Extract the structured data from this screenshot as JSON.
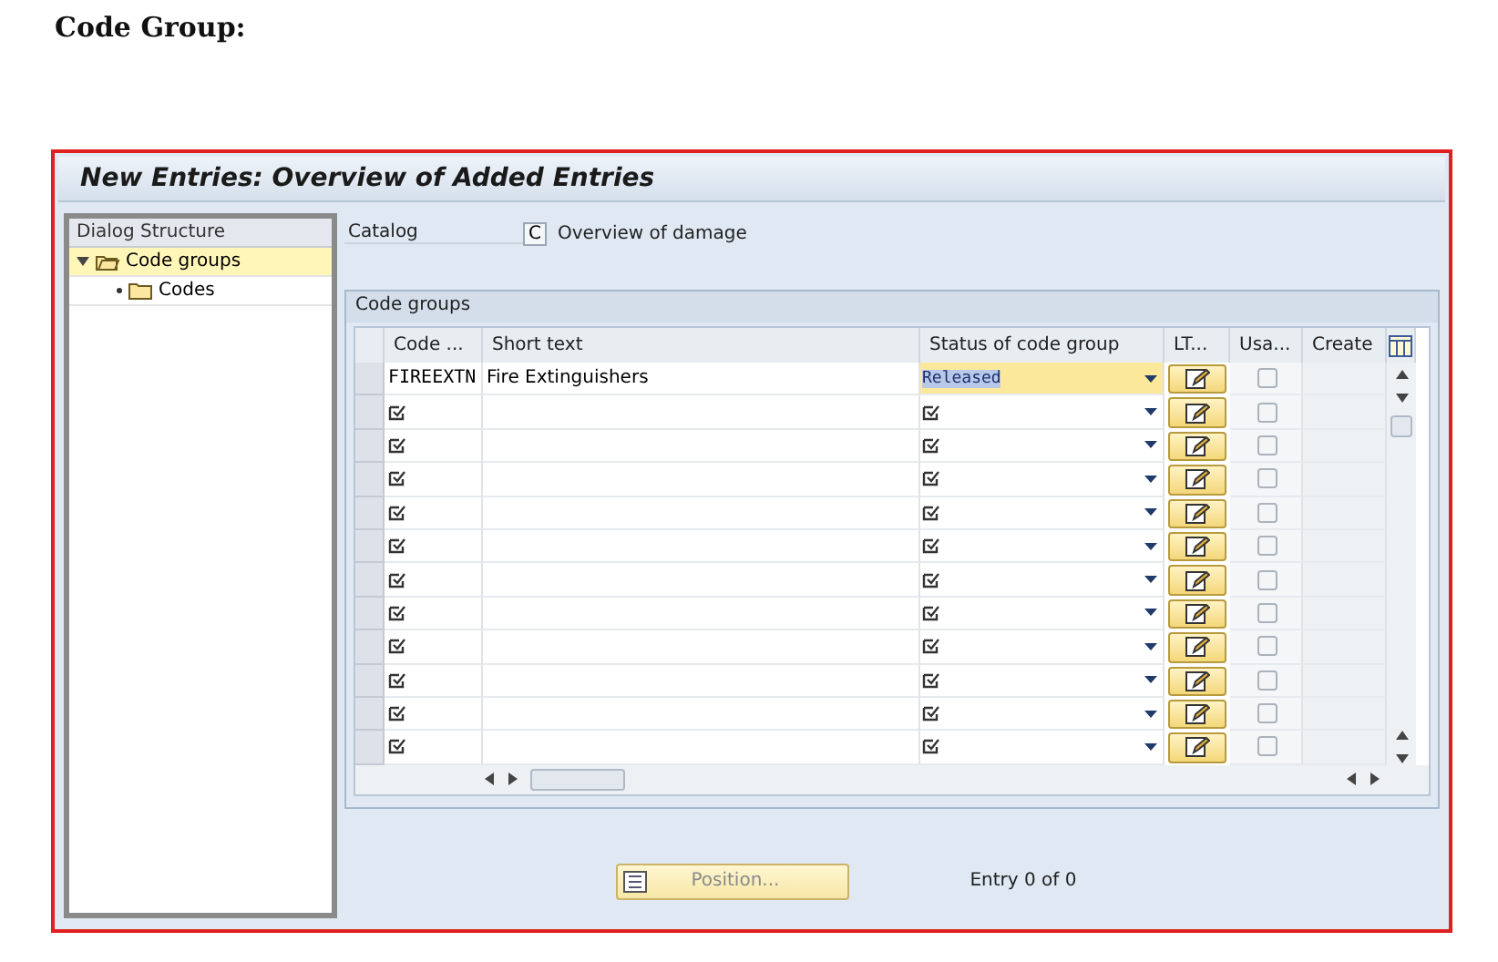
{
  "heading": "Code Group:",
  "window": {
    "title": "New Entries: Overview of Added Entries"
  },
  "dialog_structure": {
    "title": "Dialog Structure",
    "items": [
      {
        "label": "Code groups",
        "selected": true,
        "expanded": true,
        "children": [
          {
            "label": "Codes",
            "selected": false
          }
        ]
      }
    ]
  },
  "catalog": {
    "label": "Catalog",
    "value": "C",
    "description": "Overview of damage"
  },
  "table": {
    "title": "Code groups",
    "columns": [
      "Code ...",
      "Short text",
      "Status of code group",
      "LT...",
      "Usa...",
      "Create"
    ],
    "rows": [
      {
        "kind": "filled",
        "code": "FIREEXTN",
        "short_text": "Fire Extinguishers",
        "status": "Released",
        "usage_checked": false
      },
      {
        "kind": "empty",
        "usage_checked": false
      },
      {
        "kind": "empty",
        "usage_checked": false
      },
      {
        "kind": "empty",
        "usage_checked": false
      },
      {
        "kind": "empty",
        "usage_checked": false
      },
      {
        "kind": "empty",
        "usage_checked": false
      },
      {
        "kind": "empty",
        "usage_checked": false
      },
      {
        "kind": "empty",
        "usage_checked": false
      },
      {
        "kind": "empty",
        "usage_checked": false
      },
      {
        "kind": "empty",
        "usage_checked": false
      },
      {
        "kind": "empty",
        "usage_checked": false
      },
      {
        "kind": "empty",
        "usage_checked": false
      }
    ]
  },
  "footer": {
    "button": "Position...",
    "entry_info": "Entry 0 of 0"
  }
}
